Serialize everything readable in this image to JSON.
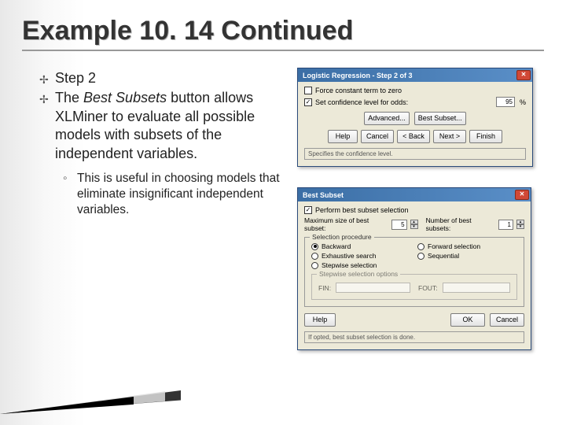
{
  "title": "Example 10. 14 Continued",
  "bullets": {
    "b1": "Step 2",
    "b2_pre": "The ",
    "b2_em": "Best Subsets",
    "b2_post": " button allows XLMiner to evaluate all possible models with subsets of the independent variables.",
    "sub1": "This is useful in choosing models that eliminate insignificant independent variables."
  },
  "dlg1": {
    "title": "Logistic Regression - Step 2 of 3",
    "cb1": "Force constant term to zero",
    "cb2": "Set confidence level for odds:",
    "conf_val": "95",
    "pct": "%",
    "btn_adv": "Advanced...",
    "btn_best": "Best Subset...",
    "btn_help": "Help",
    "btn_cancel": "Cancel",
    "btn_back": "< Back",
    "btn_next": "Next >",
    "btn_finish": "Finish",
    "status": "Specifies the confidence level."
  },
  "dlg2": {
    "title": "Best Subset",
    "cb_perform": "Perform best subset selection",
    "lbl_maxsize": "Maximum size of best subset:",
    "val_maxsize": "5",
    "lbl_numbest": "Number of best subsets:",
    "val_numbest": "1",
    "group_legend": "Selection procedure",
    "r_backward": "Backward",
    "r_forward": "Forward selection",
    "r_exhaustive": "Exhaustive search",
    "r_sequential": "Sequential",
    "r_stepwise": "Stepwise selection",
    "sub_legend": "Stepwise selection options",
    "lbl_fin": "FIN:",
    "lbl_fout": "FOUT:",
    "btn_help": "Help",
    "btn_ok": "OK",
    "btn_cancel": "Cancel",
    "status": "If opted, best subset selection is done."
  }
}
